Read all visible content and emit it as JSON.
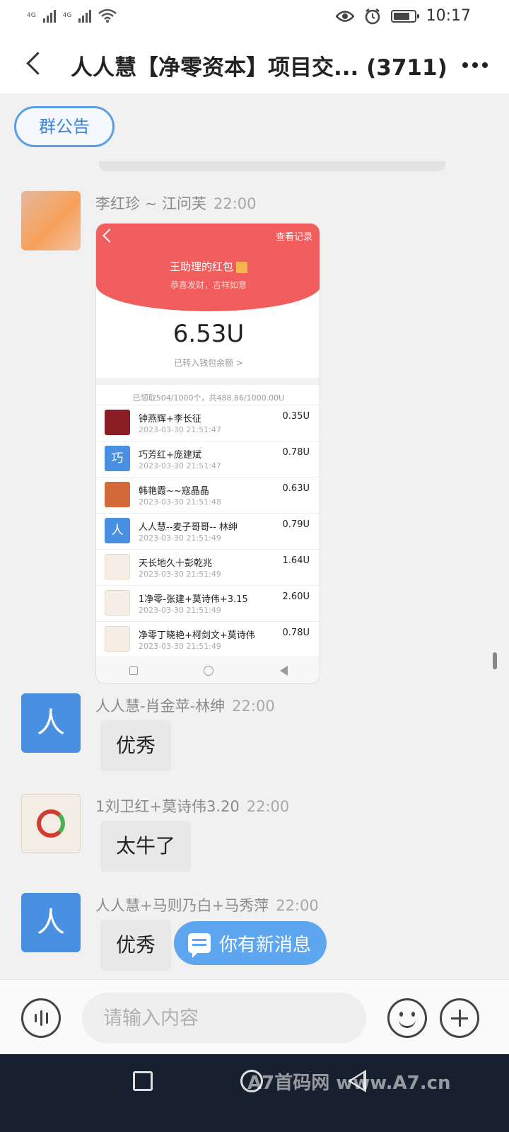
{
  "status_bar": {
    "network_1": "4G",
    "network_2": "4G",
    "time": "10:17"
  },
  "header": {
    "title": "人人慧【净零资本】项目交... (3711)"
  },
  "announcement": {
    "label": "群公告"
  },
  "messages": [
    {
      "sender": "李红珍 ~ 江问芙",
      "time": "22:00",
      "type": "image",
      "image": {
        "record_label": "查看记录",
        "packet_title": "王助理的红包",
        "packet_subtitle": "恭喜发财，吉祥如意",
        "amount": "6.53U",
        "wallet_note": "已转入钱包余额 >",
        "summary": "已领取504/1000个，共488.86/1000.00U",
        "recipients": [
          {
            "name": "钟燕辉+李长征",
            "time": "2023-03-30 21:51:47",
            "amount": "0.35U",
            "avatar": "red"
          },
          {
            "name": "巧芳红+庞建斌",
            "time": "2023-03-30 21:51:47",
            "amount": "0.78U",
            "avatar": "blue",
            "avatar_text": "巧"
          },
          {
            "name": "韩艳霞~~寇晶晶",
            "time": "2023-03-30 21:51:48",
            "amount": "0.63U",
            "avatar": "face"
          },
          {
            "name": "人人慧--麦子哥哥-- 林绅",
            "time": "2023-03-30 21:51:49",
            "amount": "0.79U",
            "avatar": "blue",
            "avatar_text": "人"
          },
          {
            "name": "天长地久十彭乾兆",
            "time": "2023-03-30 21:51:49",
            "amount": "1.64U",
            "avatar": "logo"
          },
          {
            "name": "1净零-张建+莫诗伟+3.15",
            "time": "2023-03-30 21:51:49",
            "amount": "2.60U",
            "avatar": "logo"
          },
          {
            "name": "净零丁晓艳+柯剑文+莫诗伟",
            "time": "2023-03-30 21:51:49",
            "amount": "0.78U",
            "avatar": "logo"
          }
        ]
      }
    },
    {
      "sender": "人人慧-肖金苹-林绅",
      "time": "22:00",
      "text": "优秀",
      "avatar_text": "人"
    },
    {
      "sender": "1刘卫红+莫诗伟3.20",
      "time": "22:00",
      "text": "太牛了"
    },
    {
      "sender": "人人慧+马则乃白+马秀萍",
      "time": "22:00",
      "text": "优秀",
      "avatar_text": "人"
    }
  ],
  "new_message_pill": {
    "label": "你有新消息"
  },
  "composer": {
    "placeholder": "请输入内容"
  },
  "watermark": {
    "text": "A7首码网 www.A7.cn"
  },
  "colors": {
    "accent_blue": "#4a90e2",
    "red_packet": "#f15c5c",
    "pill_blue": "#5fa6f0",
    "nav_bg": "#16202e"
  }
}
